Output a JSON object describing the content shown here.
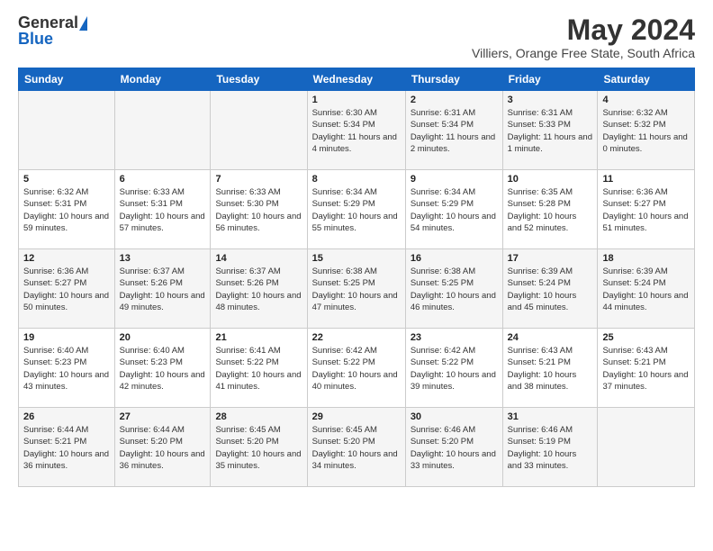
{
  "header": {
    "logo_general": "General",
    "logo_blue": "Blue",
    "month_title": "May 2024",
    "subtitle": "Villiers, Orange Free State, South Africa"
  },
  "weekdays": [
    "Sunday",
    "Monday",
    "Tuesday",
    "Wednesday",
    "Thursday",
    "Friday",
    "Saturday"
  ],
  "weeks": [
    [
      {
        "day": "",
        "info": ""
      },
      {
        "day": "",
        "info": ""
      },
      {
        "day": "",
        "info": ""
      },
      {
        "day": "1",
        "info": "Sunrise: 6:30 AM\nSunset: 5:34 PM\nDaylight: 11 hours\nand 4 minutes."
      },
      {
        "day": "2",
        "info": "Sunrise: 6:31 AM\nSunset: 5:34 PM\nDaylight: 11 hours\nand 2 minutes."
      },
      {
        "day": "3",
        "info": "Sunrise: 6:31 AM\nSunset: 5:33 PM\nDaylight: 11 hours\nand 1 minute."
      },
      {
        "day": "4",
        "info": "Sunrise: 6:32 AM\nSunset: 5:32 PM\nDaylight: 11 hours\nand 0 minutes."
      }
    ],
    [
      {
        "day": "5",
        "info": "Sunrise: 6:32 AM\nSunset: 5:31 PM\nDaylight: 10 hours\nand 59 minutes."
      },
      {
        "day": "6",
        "info": "Sunrise: 6:33 AM\nSunset: 5:31 PM\nDaylight: 10 hours\nand 57 minutes."
      },
      {
        "day": "7",
        "info": "Sunrise: 6:33 AM\nSunset: 5:30 PM\nDaylight: 10 hours\nand 56 minutes."
      },
      {
        "day": "8",
        "info": "Sunrise: 6:34 AM\nSunset: 5:29 PM\nDaylight: 10 hours\nand 55 minutes."
      },
      {
        "day": "9",
        "info": "Sunrise: 6:34 AM\nSunset: 5:29 PM\nDaylight: 10 hours\nand 54 minutes."
      },
      {
        "day": "10",
        "info": "Sunrise: 6:35 AM\nSunset: 5:28 PM\nDaylight: 10 hours\nand 52 minutes."
      },
      {
        "day": "11",
        "info": "Sunrise: 6:36 AM\nSunset: 5:27 PM\nDaylight: 10 hours\nand 51 minutes."
      }
    ],
    [
      {
        "day": "12",
        "info": "Sunrise: 6:36 AM\nSunset: 5:27 PM\nDaylight: 10 hours\nand 50 minutes."
      },
      {
        "day": "13",
        "info": "Sunrise: 6:37 AM\nSunset: 5:26 PM\nDaylight: 10 hours\nand 49 minutes."
      },
      {
        "day": "14",
        "info": "Sunrise: 6:37 AM\nSunset: 5:26 PM\nDaylight: 10 hours\nand 48 minutes."
      },
      {
        "day": "15",
        "info": "Sunrise: 6:38 AM\nSunset: 5:25 PM\nDaylight: 10 hours\nand 47 minutes."
      },
      {
        "day": "16",
        "info": "Sunrise: 6:38 AM\nSunset: 5:25 PM\nDaylight: 10 hours\nand 46 minutes."
      },
      {
        "day": "17",
        "info": "Sunrise: 6:39 AM\nSunset: 5:24 PM\nDaylight: 10 hours\nand 45 minutes."
      },
      {
        "day": "18",
        "info": "Sunrise: 6:39 AM\nSunset: 5:24 PM\nDaylight: 10 hours\nand 44 minutes."
      }
    ],
    [
      {
        "day": "19",
        "info": "Sunrise: 6:40 AM\nSunset: 5:23 PM\nDaylight: 10 hours\nand 43 minutes."
      },
      {
        "day": "20",
        "info": "Sunrise: 6:40 AM\nSunset: 5:23 PM\nDaylight: 10 hours\nand 42 minutes."
      },
      {
        "day": "21",
        "info": "Sunrise: 6:41 AM\nSunset: 5:22 PM\nDaylight: 10 hours\nand 41 minutes."
      },
      {
        "day": "22",
        "info": "Sunrise: 6:42 AM\nSunset: 5:22 PM\nDaylight: 10 hours\nand 40 minutes."
      },
      {
        "day": "23",
        "info": "Sunrise: 6:42 AM\nSunset: 5:22 PM\nDaylight: 10 hours\nand 39 minutes."
      },
      {
        "day": "24",
        "info": "Sunrise: 6:43 AM\nSunset: 5:21 PM\nDaylight: 10 hours\nand 38 minutes."
      },
      {
        "day": "25",
        "info": "Sunrise: 6:43 AM\nSunset: 5:21 PM\nDaylight: 10 hours\nand 37 minutes."
      }
    ],
    [
      {
        "day": "26",
        "info": "Sunrise: 6:44 AM\nSunset: 5:21 PM\nDaylight: 10 hours\nand 36 minutes."
      },
      {
        "day": "27",
        "info": "Sunrise: 6:44 AM\nSunset: 5:20 PM\nDaylight: 10 hours\nand 36 minutes."
      },
      {
        "day": "28",
        "info": "Sunrise: 6:45 AM\nSunset: 5:20 PM\nDaylight: 10 hours\nand 35 minutes."
      },
      {
        "day": "29",
        "info": "Sunrise: 6:45 AM\nSunset: 5:20 PM\nDaylight: 10 hours\nand 34 minutes."
      },
      {
        "day": "30",
        "info": "Sunrise: 6:46 AM\nSunset: 5:20 PM\nDaylight: 10 hours\nand 33 minutes."
      },
      {
        "day": "31",
        "info": "Sunrise: 6:46 AM\nSunset: 5:19 PM\nDaylight: 10 hours\nand 33 minutes."
      },
      {
        "day": "",
        "info": ""
      }
    ]
  ]
}
